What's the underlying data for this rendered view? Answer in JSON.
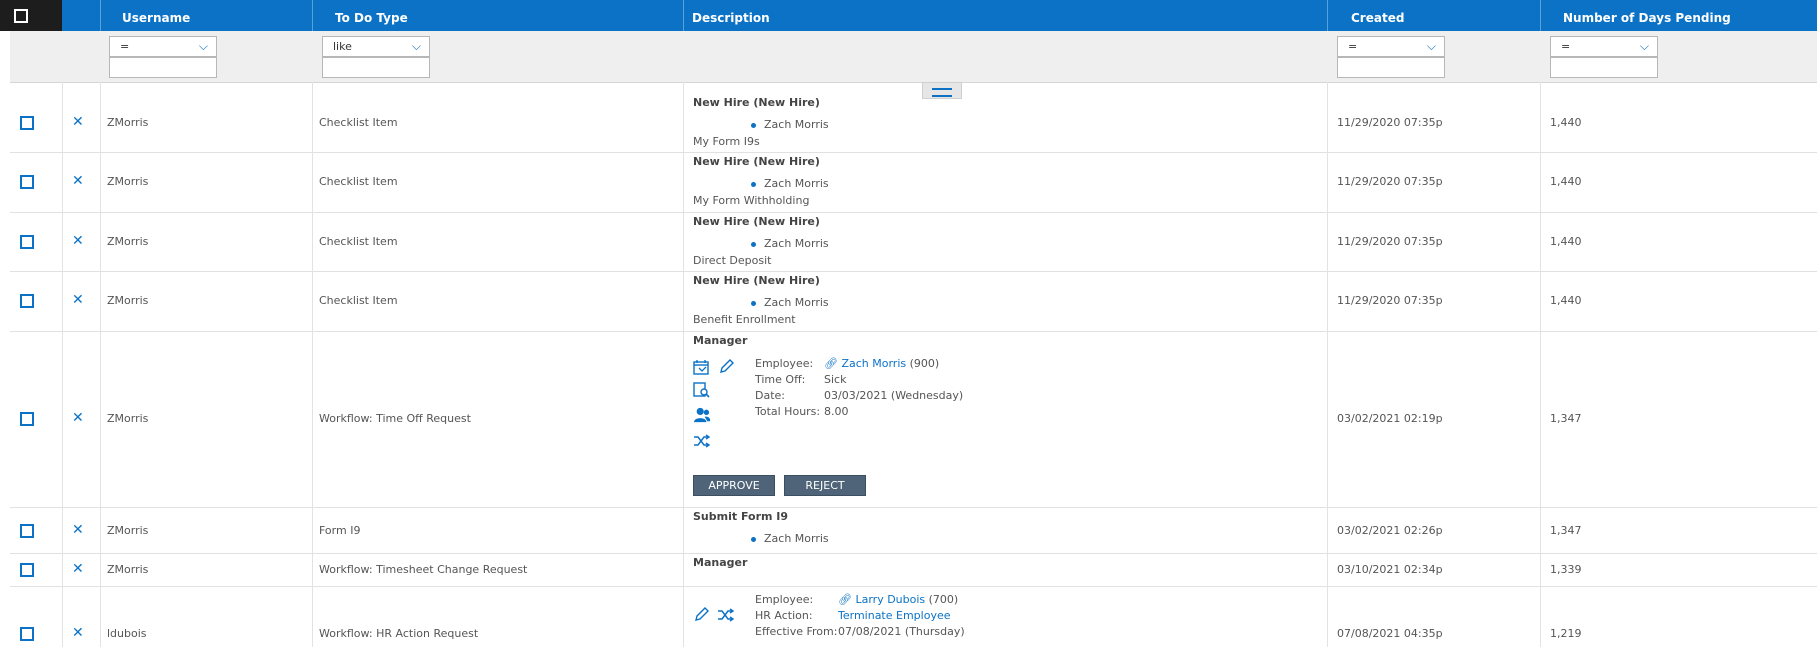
{
  "columns": {
    "username": "Username",
    "todo_type": "To Do Type",
    "description": "Description",
    "created": "Created",
    "days_pending": "Number of Days Pending"
  },
  "filters": {
    "username_op": "=",
    "todo_type_op": "like",
    "created_op": "=",
    "days_pending_op": "="
  },
  "rows": [
    {
      "username": "ZMorris",
      "type": "Checklist Item",
      "title": "New Hire (New Hire)",
      "person": "Zach Morris",
      "detail": "My Form I9s",
      "created": "11/29/2020 07:35p",
      "days": "1,440"
    },
    {
      "username": "ZMorris",
      "type": "Checklist Item",
      "title": "New Hire (New Hire)",
      "person": "Zach Morris",
      "detail": "My Form Withholding",
      "created": "11/29/2020 07:35p",
      "days": "1,440"
    },
    {
      "username": "ZMorris",
      "type": "Checklist Item",
      "title": "New Hire (New Hire)",
      "person": "Zach Morris",
      "detail": "Direct Deposit",
      "created": "11/29/2020 07:35p",
      "days": "1,440"
    },
    {
      "username": "ZMorris",
      "type": "Checklist Item",
      "title": "New Hire (New Hire)",
      "person": "Zach Morris",
      "detail": "Benefit Enrollment",
      "created": "11/29/2020 07:35p",
      "days": "1,440"
    },
    {
      "username": "ZMorris",
      "type": "Workflow: Time Off Request",
      "title": "Manager",
      "fields": [
        {
          "label": "Employee:",
          "value": "Zach Morris",
          "suffix": "(900)"
        },
        {
          "label": "Time Off:",
          "value": "Sick"
        },
        {
          "label": "Date:",
          "value": "03/03/2021 (Wednesday)"
        },
        {
          "label": "Total Hours:",
          "value": "8.00"
        }
      ],
      "approve": "APPROVE",
      "reject": "REJECT",
      "created": "03/02/2021 02:19p",
      "days": "1,347"
    },
    {
      "username": "ZMorris",
      "type": "Form I9",
      "title": "Submit Form I9",
      "person": "Zach Morris",
      "created": "03/02/2021 02:26p",
      "days": "1,347"
    },
    {
      "username": "ZMorris",
      "type": "Workflow: Timesheet Change Request",
      "title": "Manager",
      "created": "03/10/2021 02:34p",
      "days": "1,339"
    },
    {
      "username": "ldubois",
      "type": "Workflow: HR Action Request",
      "fields": [
        {
          "label": "Employee:",
          "value": "Larry Dubois",
          "suffix": "(700)"
        },
        {
          "label": "HR Action:",
          "value": "Terminate Employee"
        },
        {
          "label": "Effective From:",
          "value": "07/08/2021 (Thursday)"
        }
      ],
      "created": "07/08/2021 04:35p",
      "days": "1,219"
    }
  ]
}
